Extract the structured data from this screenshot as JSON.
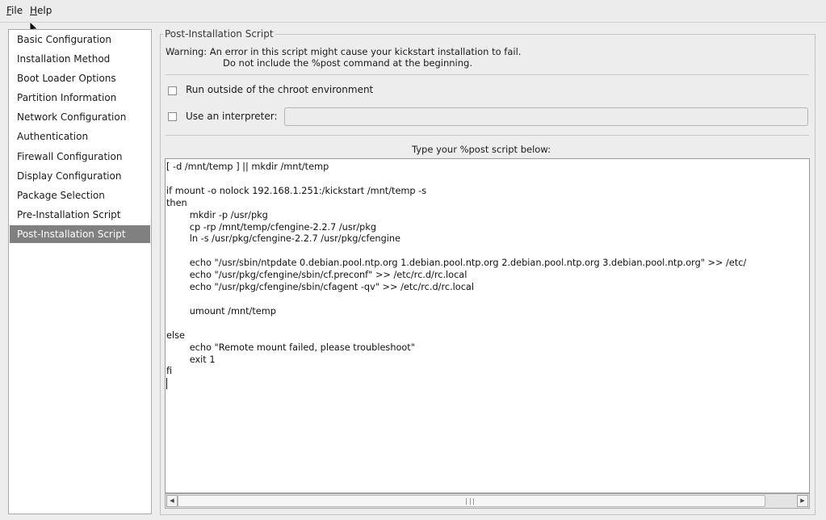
{
  "menubar": {
    "items": [
      {
        "label": "File",
        "mnemonic": "F",
        "rest": "ile"
      },
      {
        "label": "Help",
        "mnemonic": "H",
        "rest": "elp"
      }
    ]
  },
  "sidebar": {
    "items": [
      {
        "label": "Basic Configuration",
        "active": false
      },
      {
        "label": "Installation Method",
        "active": false
      },
      {
        "label": "Boot Loader Options",
        "active": false
      },
      {
        "label": "Partition Information",
        "active": false
      },
      {
        "label": "Network Configuration",
        "active": false
      },
      {
        "label": "Authentication",
        "active": false
      },
      {
        "label": "Firewall Configuration",
        "active": false
      },
      {
        "label": "Display Configuration",
        "active": false
      },
      {
        "label": "Package Selection",
        "active": false
      },
      {
        "label": "Pre-Installation Script",
        "active": false
      },
      {
        "label": "Post-Installation Script",
        "active": true
      }
    ]
  },
  "panel": {
    "title": "Post-Installation Script",
    "warning_line1": "Warning: An error in this script might cause your kickstart installation to fail.",
    "warning_line2": "Do not include the %post command at the beginning.",
    "chroot_label": "Run outside of the chroot environment",
    "chroot_checked": false,
    "interpreter_label": "Use an interpreter:",
    "interpreter_checked": false,
    "interpreter_value": "",
    "prompt": "Type your %post script below:",
    "script": "[ -d /mnt/temp ] || mkdir /mnt/temp\n\nif mount -o nolock 192.168.1.251:/kickstart /mnt/temp -s\nthen\n        mkdir -p /usr/pkg\n        cp -rp /mnt/temp/cfengine-2.2.7 /usr/pkg\n        ln -s /usr/pkg/cfengine-2.2.7 /usr/pkg/cfengine\n\n        echo \"/usr/sbin/ntpdate 0.debian.pool.ntp.org 1.debian.pool.ntp.org 2.debian.pool.ntp.org 3.debian.pool.ntp.org\" >> /etc/\n        echo \"/usr/pkg/cfengine/sbin/cf.preconf\" >> /etc/rc.d/rc.local\n        echo \"/usr/pkg/cfengine/sbin/cfagent -qv\" >> /etc/rc.d/rc.local\n\n        umount /mnt/temp\n\nelse\n        echo \"Remote mount failed, please troubleshoot\"\n        exit 1\nfi"
  },
  "icons": {
    "cursor": "arrow-cursor-icon",
    "scroll_left": "arrow-left-icon",
    "scroll_right": "arrow-right-icon",
    "grip": "scroll-grip-icon"
  },
  "colors": {
    "window_bg": "#ededed",
    "selection_bg": "#808080",
    "selection_fg": "#ffffff"
  }
}
